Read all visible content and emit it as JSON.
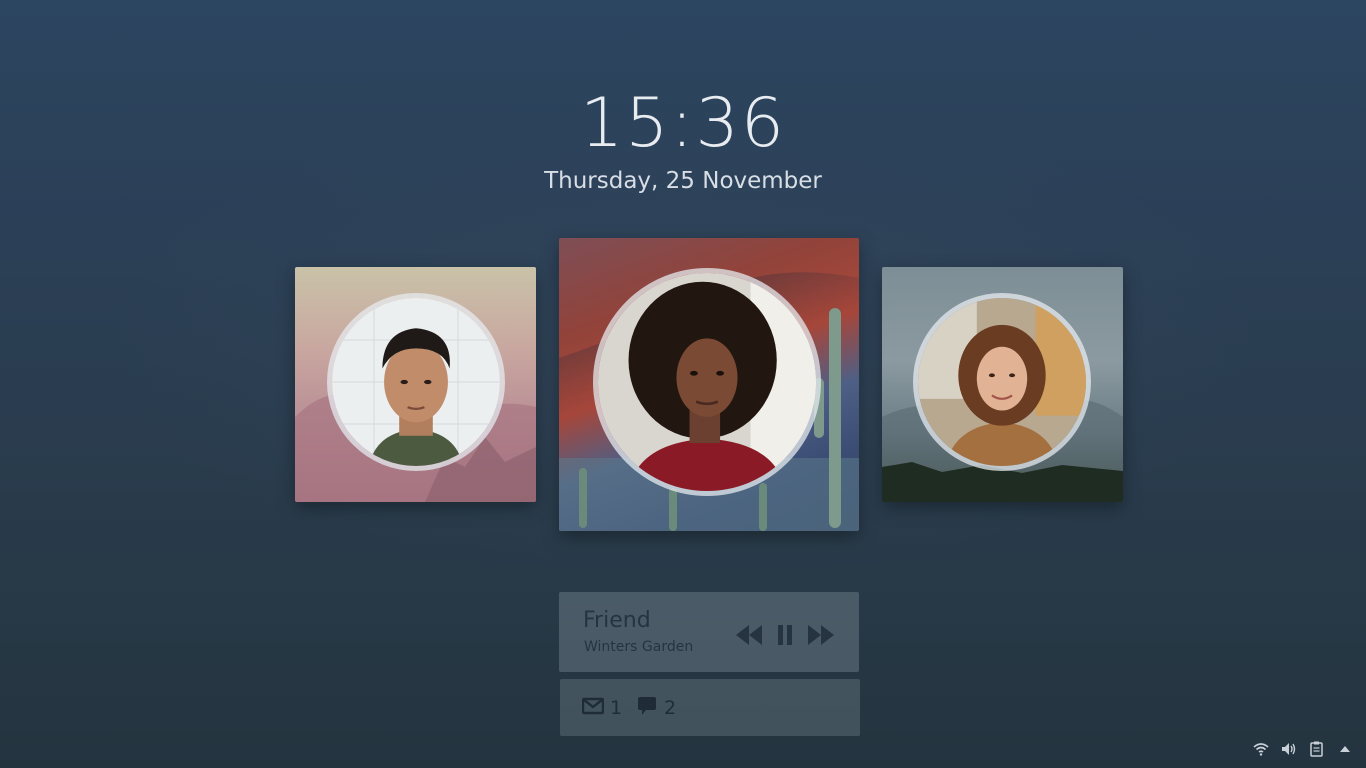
{
  "clock": {
    "time": "15:36",
    "date": "Thursday, 25 November"
  },
  "users": [
    {
      "id": "user-left",
      "avatar_icon": "user-avatar-man"
    },
    {
      "id": "user-center",
      "avatar_icon": "user-avatar-woman-curly"
    },
    {
      "id": "user-right",
      "avatar_icon": "user-avatar-woman-brown"
    }
  ],
  "media": {
    "title": "Friend",
    "artist": "Winters Garden",
    "controls": [
      "previous-icon",
      "pause-icon",
      "next-icon"
    ]
  },
  "notifications": {
    "mail_count": "1",
    "message_count": "2"
  },
  "tray": {
    "icons": [
      "wifi-icon",
      "volume-icon",
      "clipboard-icon",
      "arrow-up-icon"
    ]
  },
  "colors": {
    "background": "#2b3f55",
    "text_light": "#e8ecf0",
    "panel_text": "#263442"
  }
}
